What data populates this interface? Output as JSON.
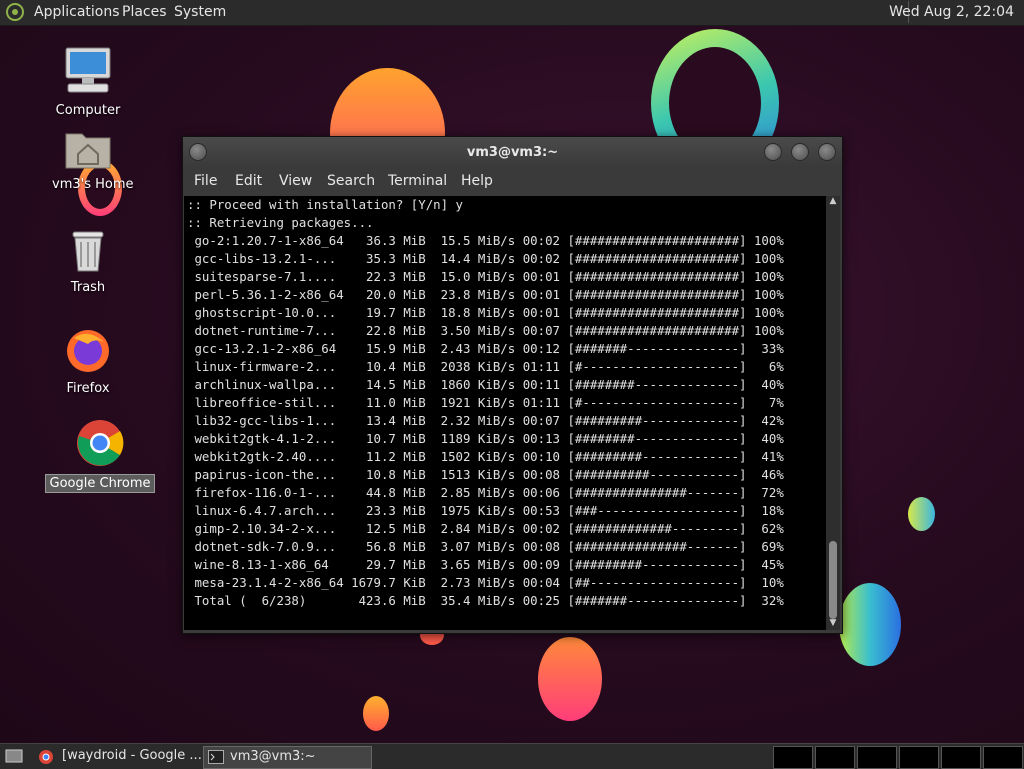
{
  "top_panel": {
    "menus": [
      "Applications",
      "Places",
      "System"
    ],
    "clock": "Wed Aug  2, 22:04"
  },
  "desktop_icons": [
    {
      "label": "Computer",
      "icon": "computer-icon"
    },
    {
      "label": "vm3's Home",
      "icon": "home-folder-icon"
    },
    {
      "label": "Trash",
      "icon": "trash-icon"
    },
    {
      "label": "Firefox",
      "icon": "firefox-icon"
    },
    {
      "label": "Google Chrome",
      "icon": "chrome-icon",
      "selected": true
    }
  ],
  "terminal": {
    "title": "vm3@vm3:~",
    "menu": [
      "File",
      "Edit",
      "View",
      "Search",
      "Terminal",
      "Help"
    ],
    "lines": [
      ":: Proceed with installation? [Y/n] y",
      ":: Retrieving packages...",
      " go-2:1.20.7-1-x86_64   36.3 MiB  15.5 MiB/s 00:02 [######################] 100%",
      " gcc-libs-13.2.1-...    35.3 MiB  14.4 MiB/s 00:02 [######################] 100%",
      " suitesparse-7.1....    22.3 MiB  15.0 MiB/s 00:01 [######################] 100%",
      " perl-5.36.1-2-x86_64   20.0 MiB  23.8 MiB/s 00:01 [######################] 100%",
      " ghostscript-10.0...    19.7 MiB  18.8 MiB/s 00:01 [######################] 100%",
      " dotnet-runtime-7...    22.8 MiB  3.50 MiB/s 00:07 [######################] 100%",
      " gcc-13.2.1-2-x86_64    15.9 MiB  2.43 MiB/s 00:12 [#######---------------]  33%",
      " linux-firmware-2...    10.4 MiB  2038 KiB/s 01:11 [#---------------------]   6%",
      " archlinux-wallpa...    14.5 MiB  1860 KiB/s 00:11 [########--------------]  40%",
      " libreoffice-stil...    11.0 MiB  1921 KiB/s 01:11 [#---------------------]   7%",
      " lib32-gcc-libs-1...    13.4 MiB  2.32 MiB/s 00:07 [#########-------------]  42%",
      " webkit2gtk-4.1-2...    10.7 MiB  1189 KiB/s 00:13 [########--------------]  40%",
      " webkit2gtk-2.40....    11.2 MiB  1502 KiB/s 00:10 [#########-------------]  41%",
      " papirus-icon-the...    10.8 MiB  1513 KiB/s 00:08 [##########------------]  46%",
      " firefox-116.0-1-...    44.8 MiB  2.85 MiB/s 00:06 [###############-------]  72%",
      " linux-6.4.7.arch...    23.3 MiB  1975 KiB/s 00:53 [###-------------------]  18%",
      " gimp-2.10.34-2-x...    12.5 MiB  2.84 MiB/s 00:02 [#############---------]  62%",
      " dotnet-sdk-7.0.9...    56.8 MiB  3.07 MiB/s 00:08 [###############-------]  69%",
      " wine-8.13-1-x86_64     29.7 MiB  3.65 MiB/s 00:09 [#########-------------]  45%",
      " mesa-23.1.4-2-x86_64 1679.7 KiB  2.73 MiB/s 00:04 [##--------------------]  10%",
      " Total (  6/238)       423.6 MiB  35.4 MiB/s 00:25 [#######---------------]  32%"
    ]
  },
  "taskbar": {
    "tasks": [
      {
        "label": "[waydroid - Google ...",
        "icon": "chrome-icon"
      },
      {
        "label": "vm3@vm3:~",
        "icon": "terminal-icon"
      }
    ]
  }
}
